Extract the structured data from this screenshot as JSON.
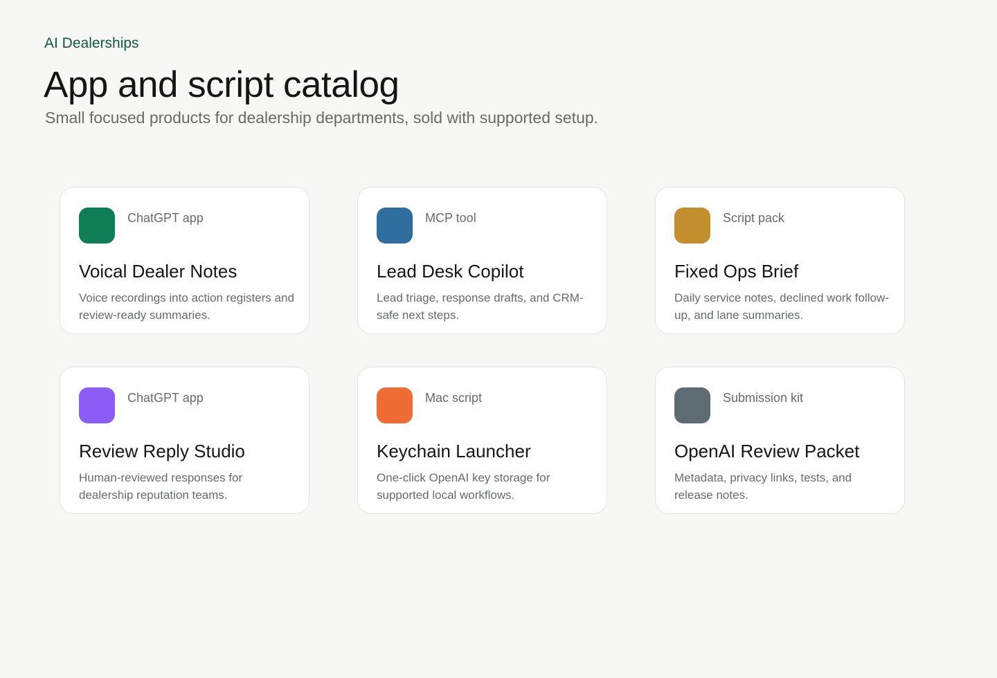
{
  "header": {
    "eyebrow": "AI Dealerships",
    "title": "App and script catalog",
    "subtitle": "Small focused products for dealership departments, sold with supported setup."
  },
  "catalog": {
    "items": [
      {
        "type": "ChatGPT app",
        "name": "Voical Dealer Notes",
        "description": "Voice recordings into action registers and review-ready summaries.",
        "color": "#0f7e57"
      },
      {
        "type": "MCP tool",
        "name": "Lead Desk Copilot",
        "description": "Lead triage, response drafts, and CRM-safe next steps.",
        "color": "#2f6e9e"
      },
      {
        "type": "Script pack",
        "name": "Fixed Ops Brief",
        "description": "Daily service notes, declined work follow-up, and lane summaries.",
        "color": "#c28e2e"
      },
      {
        "type": "ChatGPT app",
        "name": "Review Reply Studio",
        "description": "Human-reviewed responses for dealership reputation teams.",
        "color": "#8b5cf6"
      },
      {
        "type": "Mac script",
        "name": "Keychain Launcher",
        "description": "One-click OpenAI key storage for supported local workflows.",
        "color": "#ef6c35"
      },
      {
        "type": "Submission kit",
        "name": "OpenAI Review Packet",
        "description": "Metadata, privacy links, tests, and release notes.",
        "color": "#5e6b73"
      }
    ]
  }
}
